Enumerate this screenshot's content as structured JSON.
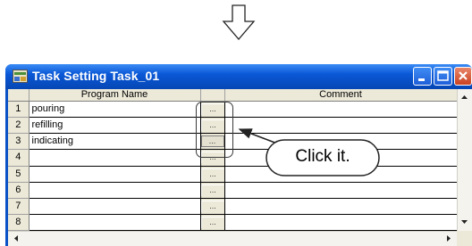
{
  "window": {
    "title": "Task Setting Task_01",
    "titlebar_color": "#0a52c6",
    "controls": [
      "minimize-icon",
      "maximize-icon",
      "close-icon"
    ]
  },
  "table": {
    "headers": {
      "row_number": "",
      "program_name": "Program Name",
      "button": "",
      "comment": "Comment"
    },
    "button_glyph": "...",
    "rows": [
      {
        "num": "1",
        "program": "pouring",
        "comment": ""
      },
      {
        "num": "2",
        "program": "refilling",
        "comment": ""
      },
      {
        "num": "3",
        "program": "indicating",
        "comment": ""
      },
      {
        "num": "4",
        "program": "",
        "comment": ""
      },
      {
        "num": "5",
        "program": "",
        "comment": ""
      },
      {
        "num": "6",
        "program": "",
        "comment": ""
      },
      {
        "num": "7",
        "program": "",
        "comment": ""
      },
      {
        "num": "8",
        "program": "",
        "comment": ""
      }
    ]
  },
  "annotation": {
    "callout_text": "Click it.",
    "icons": [
      "down-arrow-icon",
      "pointer-arrow-icon"
    ]
  }
}
